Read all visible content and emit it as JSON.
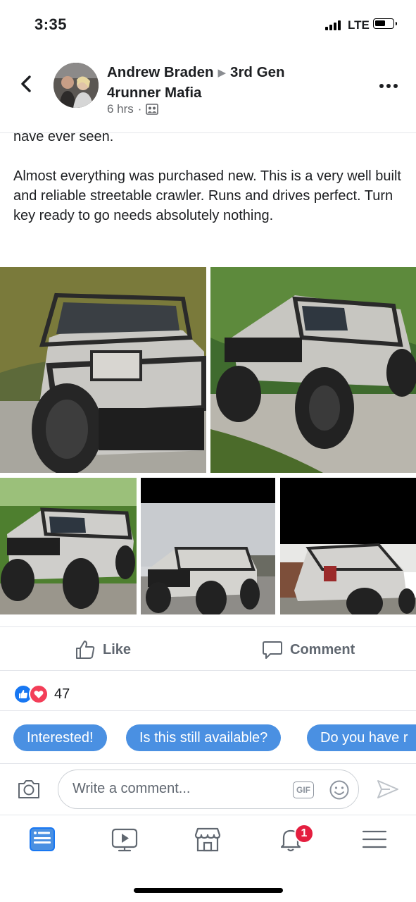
{
  "status_bar": {
    "time": "3:35",
    "network": "LTE"
  },
  "post": {
    "author": "Andrew Braden",
    "group": "3rd Gen 4runner Mafia",
    "time_ago": "6 hrs",
    "text_partial": "have ever seen.",
    "text_main": "Almost everything was purchased new. This is a very well built and reliable streetable crawler. Runs and drives perfect. Turn key ready to go needs absolutely nothing."
  },
  "icons": {
    "back": "chevron-left-icon",
    "more": "more-horizontal-icon",
    "audience": "group-icon"
  },
  "actions": {
    "like_label": "Like",
    "comment_label": "Comment"
  },
  "reactions": {
    "count": "47",
    "like_color": "#1877f2",
    "love_color": "#f33e58"
  },
  "quick_replies": [
    "Interested!",
    "Is this still available?",
    "Do you have r"
  ],
  "comment": {
    "placeholder": "Write a comment...",
    "gif_label": "GIF"
  },
  "tabbar": {
    "items": [
      "news-feed-icon",
      "watch-icon",
      "marketplace-icon",
      "notifications-icon",
      "menu-icon"
    ],
    "active": "news-feed-icon",
    "notification_badge": "1"
  },
  "colors": {
    "chip_bg": "#4a90e2",
    "accent": "#1877f2",
    "badge": "#e41e3f"
  }
}
